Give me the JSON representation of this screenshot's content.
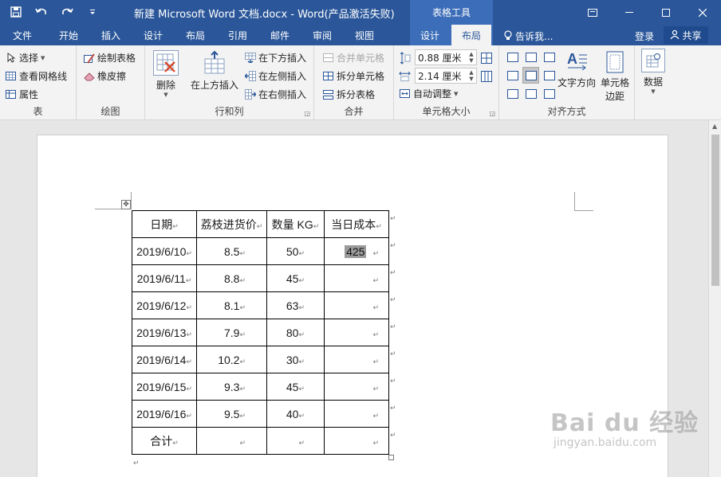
{
  "titlebar": {
    "title": "新建 Microsoft Word 文档.docx - Word(产品激活失败)",
    "context_title": "表格工具",
    "qat": [
      "save-icon",
      "undo-icon",
      "redo-icon",
      "customize-icon"
    ]
  },
  "tabs": [
    {
      "label": "文件"
    },
    {
      "label": "开始"
    },
    {
      "label": "插入"
    },
    {
      "label": "设计"
    },
    {
      "label": "布局"
    },
    {
      "label": "引用"
    },
    {
      "label": "邮件"
    },
    {
      "label": "审阅"
    },
    {
      "label": "视图"
    },
    {
      "label": "设计"
    },
    {
      "label": "布局"
    }
  ],
  "tellme": "告诉我...",
  "login": "登录",
  "share": "共享",
  "ribbon": {
    "table": {
      "select": "选择",
      "gridlines": "查看网格线",
      "properties": "属性",
      "label": "表"
    },
    "draw": {
      "draw_table": "绘制表格",
      "eraser": "橡皮擦",
      "label": "绘图"
    },
    "rows_cols": {
      "delete": "删除",
      "insert_above": "在上方插入",
      "insert_below": "在下方插入",
      "insert_left": "在左侧插入",
      "insert_right": "在右侧插入",
      "label": "行和列"
    },
    "merge": {
      "merge_cells": "合并单元格",
      "split_cells": "拆分单元格",
      "split_table": "拆分表格",
      "label": "合并"
    },
    "cell_size": {
      "height": "0.88 厘米",
      "width": "2.14 厘米",
      "autofit": "自动调整",
      "label": "单元格大小"
    },
    "alignment": {
      "text_direction": "文字方向",
      "cell_margins_1": "单元格",
      "cell_margins_2": "边距",
      "label": "对齐方式"
    },
    "data": {
      "label": "数据"
    }
  },
  "table": {
    "headers": [
      "日期",
      "荔枝进货价",
      "数量 KG",
      "当日成本"
    ],
    "rows": [
      [
        "2019/6/10",
        "8.5",
        "50",
        "425"
      ],
      [
        "2019/6/11",
        "8.8",
        "45",
        ""
      ],
      [
        "2019/6/12",
        "8.1",
        "63",
        ""
      ],
      [
        "2019/6/13",
        "7.9",
        "80",
        ""
      ],
      [
        "2019/6/14",
        "10.2",
        "30",
        ""
      ],
      [
        "2019/6/15",
        "9.3",
        "45",
        ""
      ],
      [
        "2019/6/16",
        "9.5",
        "40",
        ""
      ]
    ],
    "total_label": "合计"
  },
  "watermark": {
    "main": "Bai du 经验",
    "url": "jingyan.baidu.com"
  }
}
